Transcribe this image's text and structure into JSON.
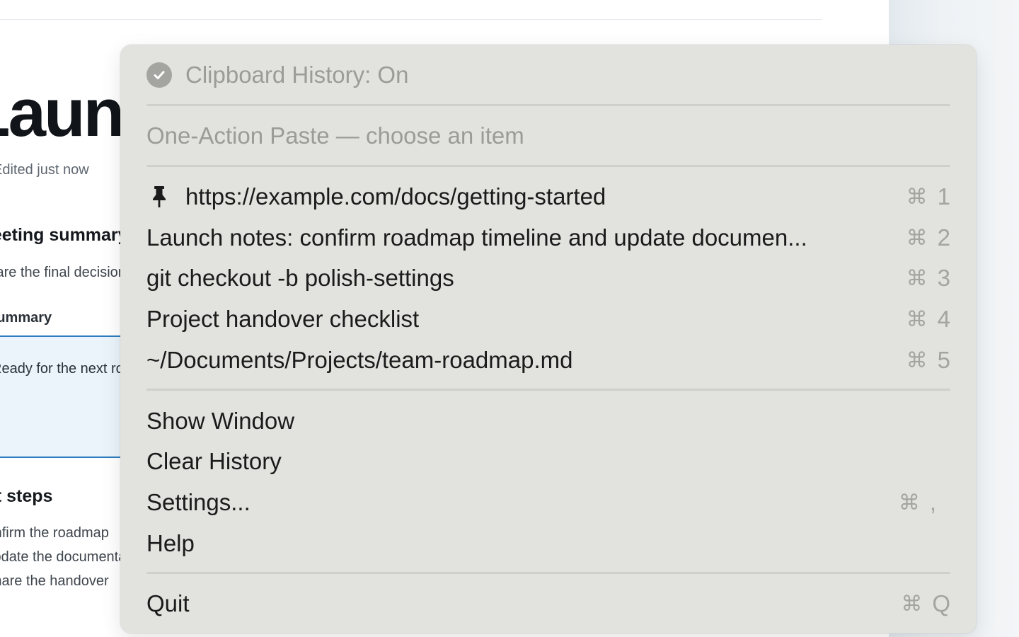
{
  "document": {
    "title": "Launc",
    "edited": "Edited just now",
    "section_heading": "Meeting summary",
    "section_text": "Share the final decisions",
    "summary_label": "Summary",
    "callout_text": "Ready for the next round",
    "steps_heading": "Next steps",
    "steps": [
      "Confirm the roadmap",
      "Update the documentation",
      "Share the handover"
    ]
  },
  "menu": {
    "status": {
      "icon": "check-circle-icon",
      "label": "Clipboard History: On"
    },
    "section_header": "One-Action Paste — choose an item",
    "history_items": [
      {
        "icon": "pin-icon",
        "label": "https://example.com/docs/getting-started",
        "shortcut_symbol": "⌘",
        "shortcut_key": "1"
      },
      {
        "label": "Launch notes: confirm roadmap timeline and update documen...",
        "shortcut_symbol": "⌘",
        "shortcut_key": "2"
      },
      {
        "label": "git checkout -b polish-settings",
        "shortcut_symbol": "⌘",
        "shortcut_key": "3"
      },
      {
        "label": "Project handover checklist",
        "shortcut_symbol": "⌘",
        "shortcut_key": "4"
      },
      {
        "label": "~/Documents/Projects/team-roadmap.md",
        "shortcut_symbol": "⌘",
        "shortcut_key": "5"
      }
    ],
    "actions": [
      {
        "label": "Show Window"
      },
      {
        "label": "Clear History"
      },
      {
        "label": "Settings...",
        "shortcut_symbol": "⌘",
        "shortcut_key": ","
      },
      {
        "label": "Help"
      }
    ],
    "quit": {
      "label": "Quit",
      "shortcut_symbol": "⌘",
      "shortcut_key": "Q"
    }
  },
  "colors": {
    "menu_background": "#e2e2df",
    "disabled_text": "#9b9b98",
    "shortcut_text": "#a4a4a1",
    "accent_blue": "#2b7cc0"
  }
}
